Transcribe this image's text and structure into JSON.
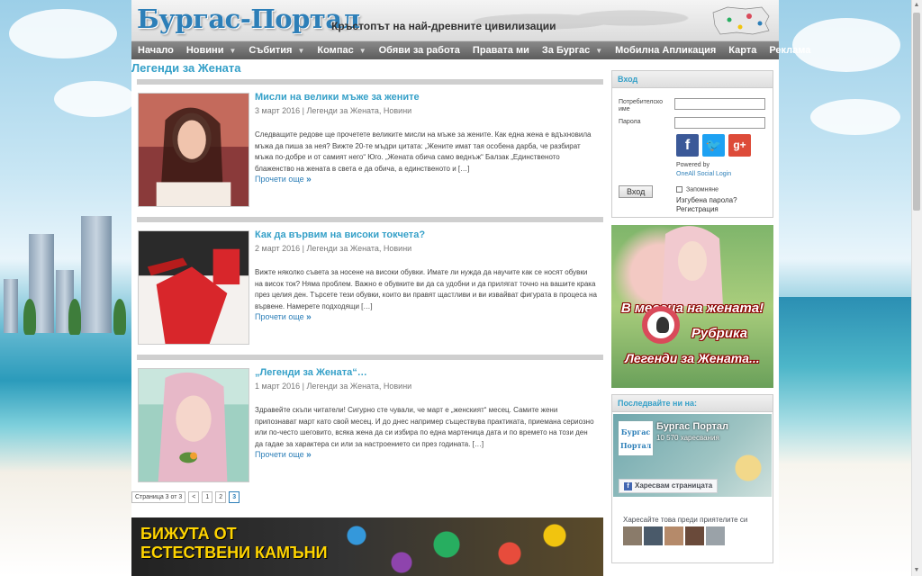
{
  "header": {
    "logo": "Бургас-Портал",
    "tagline": "Кръстопът на най-древните цивилизации"
  },
  "nav": [
    {
      "label": "Начало",
      "dropdown": false
    },
    {
      "label": "Новини",
      "dropdown": true
    },
    {
      "label": "Събития",
      "dropdown": true
    },
    {
      "label": "Компас",
      "dropdown": true
    },
    {
      "label": "Обяви за работа",
      "dropdown": false
    },
    {
      "label": "Правата ми",
      "dropdown": false
    },
    {
      "label": "За Бургас",
      "dropdown": true
    },
    {
      "label": "Мобилна Апликация",
      "dropdown": false
    },
    {
      "label": "Карта",
      "dropdown": false
    },
    {
      "label": "Реклама",
      "dropdown": false
    }
  ],
  "page_title": "Легенди за Жената",
  "posts": [
    {
      "title": "Мисли на велики мъже за жените",
      "meta": "3 март 2016 | Легенди за Жената, Новини",
      "excerpt": "Следващите редове ще прочетете великите мисли на мъже за жените. Как една жена е вдъхновила мъжа да пиша за нея? Вижте 20-те мъдри цитата: „Жените имат тая особена дарба, че разбират мъжа по-добре и от самият него“ Юго. „Жената обича само веднъж“ Балзак „Единственото блаженство на жената в света е да обича, а единственото и […]",
      "read_more": "Прочети още"
    },
    {
      "title": "Как да вървим на високи токчета?",
      "meta": "2 март 2016 | Легенди за Жената, Новини",
      "excerpt": "Вижте няколко съвета за носене на високи обувки. Имате ли нужда да научите как се носят обувки на висок ток? Няма проблем. Важно е обувките ви да са удобни и да прилягат точно на вашите крака през целия ден. Търсете тези обувки, които ви правят щастливи и ви извайват фигурата в процеса на вървене. Намерете подходящи […]",
      "read_more": "Прочети още"
    },
    {
      "title": "„Легенди за Жената“…",
      "meta": "1 март 2016 | Легенди за Жената, Новини",
      "excerpt": "Здравейте скъпи читатели! Сигурно  сте чували, че март е „женският“ месец. Самите жени припознават март като свой месец. И до днес например съществува практиката, приемана сериозно или по-често шеговито, всяка жена да си избира по една мартеница дата и по времето на този ден да гадае за характера си или за настроението си през годината. […]",
      "read_more": "Прочети още"
    }
  ],
  "pager": {
    "status": "Страница 3 от 3",
    "prev": "<",
    "pages": [
      "1",
      "2",
      "3"
    ],
    "current": "3"
  },
  "banner": {
    "line1": "БИЖУТА ОТ",
    "line2": "ЕСТЕСТВЕНИ КАМЪНИ"
  },
  "login": {
    "heading": "Вход",
    "username_label": "Потребителско име",
    "password_label": "Парола",
    "powered_by": "Powered by",
    "powered_link": "OneAll Social Login",
    "button": "Вход",
    "remember": "Запомняне",
    "forgot": "Изгубена парола?",
    "register": "Регистрация"
  },
  "promo": {
    "line1": "В месеца на жената!",
    "line2": "Рубрика",
    "line3": "Легенди за Жената..."
  },
  "follow": {
    "heading": "Последвайте ни на:",
    "page_name": "Бургас Портал",
    "likes": "10 570 харесвания",
    "like_button": "Харесвам страницата",
    "friends_text": "Харесайте това преди приятелите си",
    "avatar_text": "Бургас Портал"
  },
  "colors": {
    "accent": "#35a0c8",
    "link": "#2d7fb8",
    "nav": "#6b6b6b",
    "facebook": "#3b5998",
    "twitter": "#1da1f2",
    "gplus": "#dd4b39"
  }
}
